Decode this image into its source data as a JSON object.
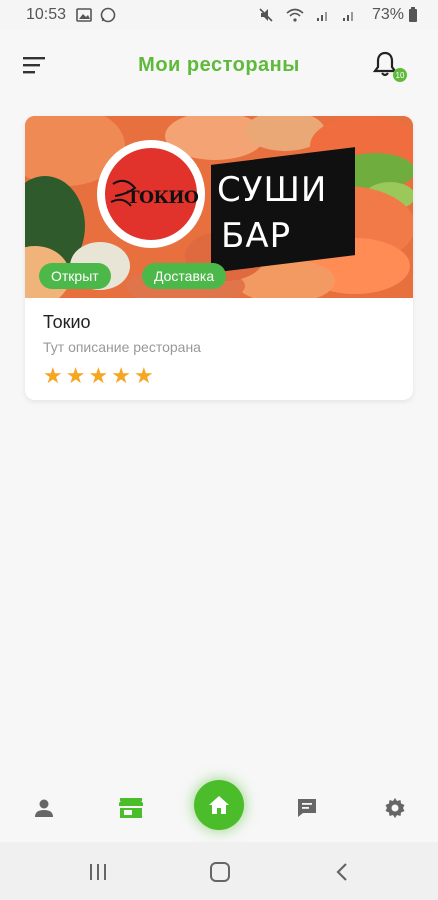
{
  "status_bar": {
    "time": "10:53",
    "battery": "73%",
    "icons": [
      "image-icon",
      "whatsapp-icon",
      "mute-icon",
      "wifi-icon",
      "signal-icon",
      "signal-icon",
      "battery-icon"
    ]
  },
  "app_bar": {
    "title": "Мои рестораны",
    "notification_count": "10",
    "accent_color": "#5fba3c"
  },
  "restaurants": [
    {
      "name": "Токио",
      "description": "Тут описание ресторана",
      "rating": 5,
      "rating_max": 5,
      "image": {
        "logo_text": "ТОКИО",
        "banner_line1": "СУШИ",
        "banner_line2": "БАР"
      },
      "tags": [
        "Открыт",
        "Доставка"
      ],
      "tag_color": "#4db84a"
    }
  ],
  "bottom_nav": {
    "items": [
      "profile-icon",
      "store-icon",
      "home-icon",
      "chat-icon",
      "settings-icon"
    ],
    "active": "store-icon",
    "active_color": "#4bbd2a"
  },
  "system_nav": [
    "recents-button",
    "home-button",
    "back-button"
  ]
}
